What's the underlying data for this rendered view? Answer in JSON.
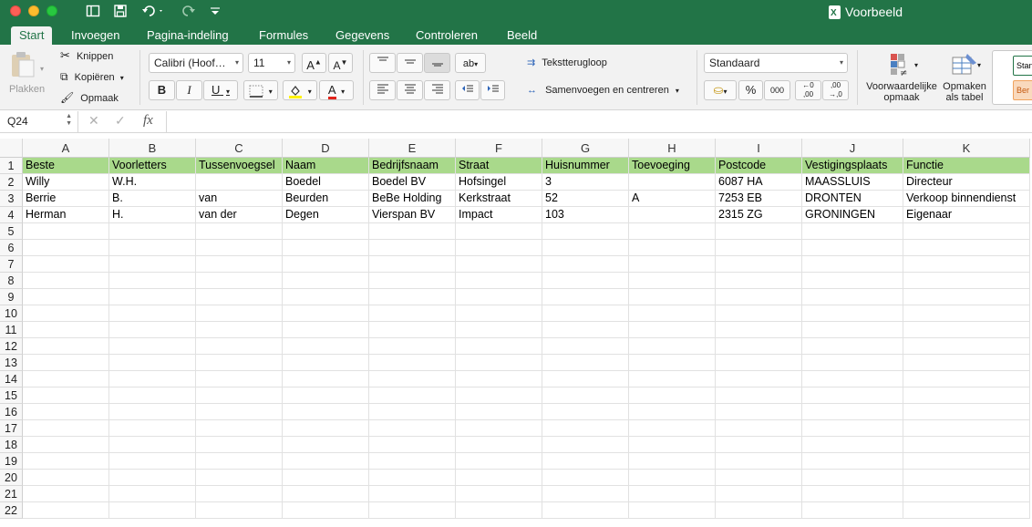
{
  "window": {
    "title": "Voorbeeld"
  },
  "tabs": [
    "Start",
    "Invoegen",
    "Pagina-indeling",
    "Formules",
    "Gegevens",
    "Controleren",
    "Beeld"
  ],
  "ribbon": {
    "paste_label": "Plakken",
    "cut_label": "Knippen",
    "copy_label": "Kopiëren",
    "format_painter_label": "Opmaak",
    "font_name": "Calibri (Hoof…",
    "font_size": "11",
    "bold": "B",
    "italic": "I",
    "underline": "U",
    "wrap_text_label": "Tekstterugloop",
    "merge_center_label": "Samenvoegen en centreren",
    "number_format": "Standaard",
    "percent": "%",
    "thousands": "000",
    "conditional_formatting_label_1": "Voorwaardelijke",
    "conditional_formatting_label_2": "opmaak",
    "format_as_table_label_1": "Opmaken",
    "format_as_table_label_2": "als tabel",
    "style_label_1": "Stan",
    "style_label_2": "Ber"
  },
  "formula_bar": {
    "name_box": "Q24",
    "fx": "fx",
    "value": ""
  },
  "sheet": {
    "columns": [
      "A",
      "B",
      "C",
      "D",
      "E",
      "F",
      "G",
      "H",
      "I",
      "J",
      "K"
    ],
    "header_color": "#a9d98b",
    "rows": [
      [
        "Beste",
        "Voorletters",
        "Tussenvoegsel",
        "Naam",
        "Bedrijfsnaam",
        "Straat",
        "Huisnummer",
        "Toevoeging",
        "Postcode",
        "Vestigingsplaats",
        "Functie"
      ],
      [
        "Willy",
        "W.H.",
        "",
        "Boedel",
        "Boedel BV",
        "Hofsingel",
        "3",
        "",
        "6087 HA",
        "MAASSLUIS",
        "Directeur"
      ],
      [
        "Berrie",
        "B.",
        "van",
        "Beurden",
        "BeBe Holding",
        "Kerkstraat",
        "52",
        "A",
        "7253 EB",
        "DRONTEN",
        "Verkoop binnendienst"
      ],
      [
        "Herman",
        "H.",
        "van der",
        "Degen",
        "Vierspan BV",
        "Impact",
        "103",
        "",
        "2315 ZG",
        "GRONINGEN",
        "Eigenaar"
      ]
    ],
    "row_numbers": [
      "1",
      "2",
      "3",
      "4",
      "5",
      "6",
      "7",
      "8",
      "9",
      "10",
      "11",
      "12",
      "13",
      "14",
      "15",
      "16",
      "17",
      "18",
      "19",
      "20",
      "21",
      "22"
    ]
  }
}
